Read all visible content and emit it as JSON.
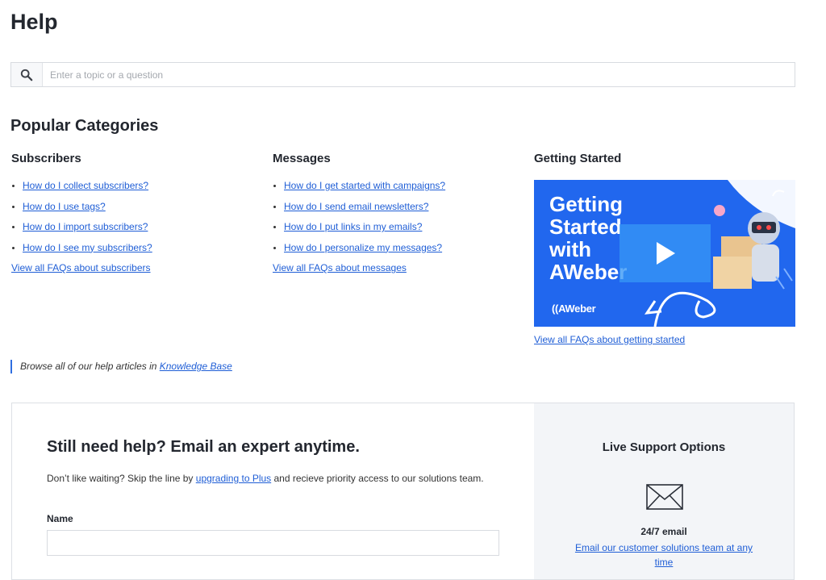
{
  "page": {
    "title": "Help"
  },
  "search": {
    "placeholder": "Enter a topic or a question"
  },
  "popular": {
    "title": "Popular Categories",
    "columns": [
      {
        "heading": "Subscribers",
        "links": [
          "How do I collect subscribers?",
          "How do I use tags?",
          "How do I import subscribers?",
          "How do I see my subscribers?"
        ],
        "view_all": "View all FAQs about subscribers"
      },
      {
        "heading": "Messages",
        "links": [
          "How do I get started with campaigns?",
          "How do I send email newsletters?",
          "How do I put links in my emails?",
          "How do I personalize my messages?"
        ],
        "view_all": "View all FAQs about messages"
      },
      {
        "heading": "Getting Started",
        "video": {
          "text": "Getting\nStarted\nwith\nAWeber",
          "logo": "AWeber",
          "bg_color": "#2167ee"
        },
        "view_all": "View all FAQs about getting started"
      }
    ]
  },
  "browse": {
    "prefix": "Browse all of our help articles in ",
    "link": "Knowledge Base"
  },
  "contact": {
    "title": "Still need help? Email an expert anytime.",
    "desc_prefix": "Don’t like waiting? Skip the line by ",
    "desc_link": "upgrading to Plus",
    "desc_suffix": " and recieve priority access to our solutions team.",
    "name_label": "Name"
  },
  "live_support": {
    "title": "Live Support Options",
    "email_heading": "24/7 email",
    "email_link": "Email our customer solutions team at any time",
    "icon": "envelope-icon"
  },
  "colors": {
    "link": "#1f5ed6",
    "accent": "#2f6ee0",
    "panel_bg": "#f3f5f8"
  }
}
